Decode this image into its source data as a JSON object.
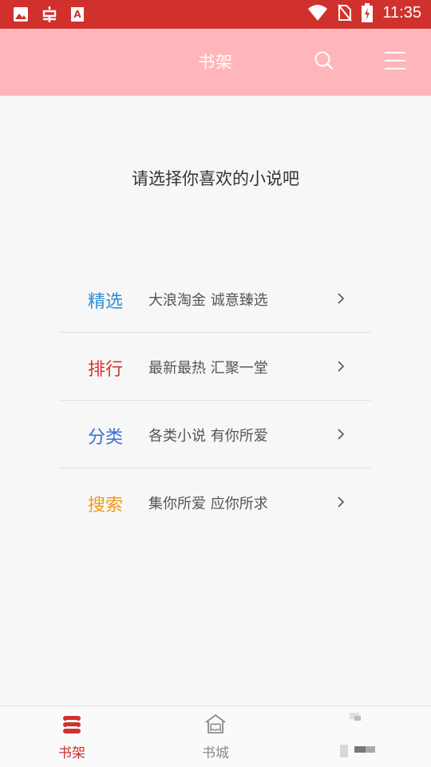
{
  "status_bar": {
    "time": "11:35",
    "left_icons": [
      "image-icon",
      "bug-icon",
      "text-a-icon"
    ],
    "right_icons": [
      "wifi-icon",
      "no-sim-icon",
      "battery-charging-icon"
    ]
  },
  "app_bar": {
    "title": "书架",
    "actions": [
      "search-icon",
      "menu-icon"
    ]
  },
  "prompt": "请选择你喜欢的小说吧",
  "menu": [
    {
      "title": "精选",
      "desc": "大浪淘金  诚意臻选",
      "color": "#2b8fd6"
    },
    {
      "title": "排行",
      "desc": "最新最热  汇聚一堂",
      "color": "#d63535"
    },
    {
      "title": "分类",
      "desc": "各类小说  有你所爱",
      "color": "#3c6fd6"
    },
    {
      "title": "搜索",
      "desc": "集你所爱  应你所求",
      "color": "#ef9a1a"
    }
  ],
  "bottom_nav": [
    {
      "label": "书架",
      "icon": "bookshelf-icon",
      "active": true
    },
    {
      "label": "书城",
      "icon": "bookstore-icon",
      "active": false
    },
    {
      "label": "",
      "icon": "blurred-icon",
      "active": false
    }
  ],
  "colors": {
    "status_bar": "#d0312d",
    "app_bar": "#ffb6bb",
    "active_tab": "#d0312d",
    "inactive_tab": "#8a8a8a"
  }
}
